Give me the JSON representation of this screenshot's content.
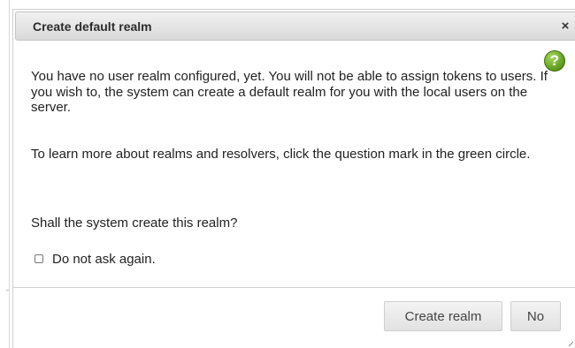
{
  "dialog": {
    "title": "Create default realm",
    "close_glyph": "×",
    "help_glyph": "?",
    "help_icon": "question-mark-green-circle",
    "paragraphs": [
      "You have no user realm configured, yet. You will not be able to assign tokens to users. If you wish to, the system can create a default realm for you with the local users on the server.",
      "To learn more about realms and resolvers, click the question mark in the green circle.",
      "Shall the system create this realm?"
    ],
    "checkbox": {
      "label": "Do not ask again.",
      "checked": false
    },
    "buttons": {
      "create_label": "Create realm",
      "no_label": "No"
    }
  },
  "colors": {
    "help_icon_green": "#5c9b1c",
    "titlebar_gradient_top": "#f1f1f1",
    "titlebar_gradient_bottom": "#d9d9d9",
    "button_bg": "#e8e8e8"
  }
}
